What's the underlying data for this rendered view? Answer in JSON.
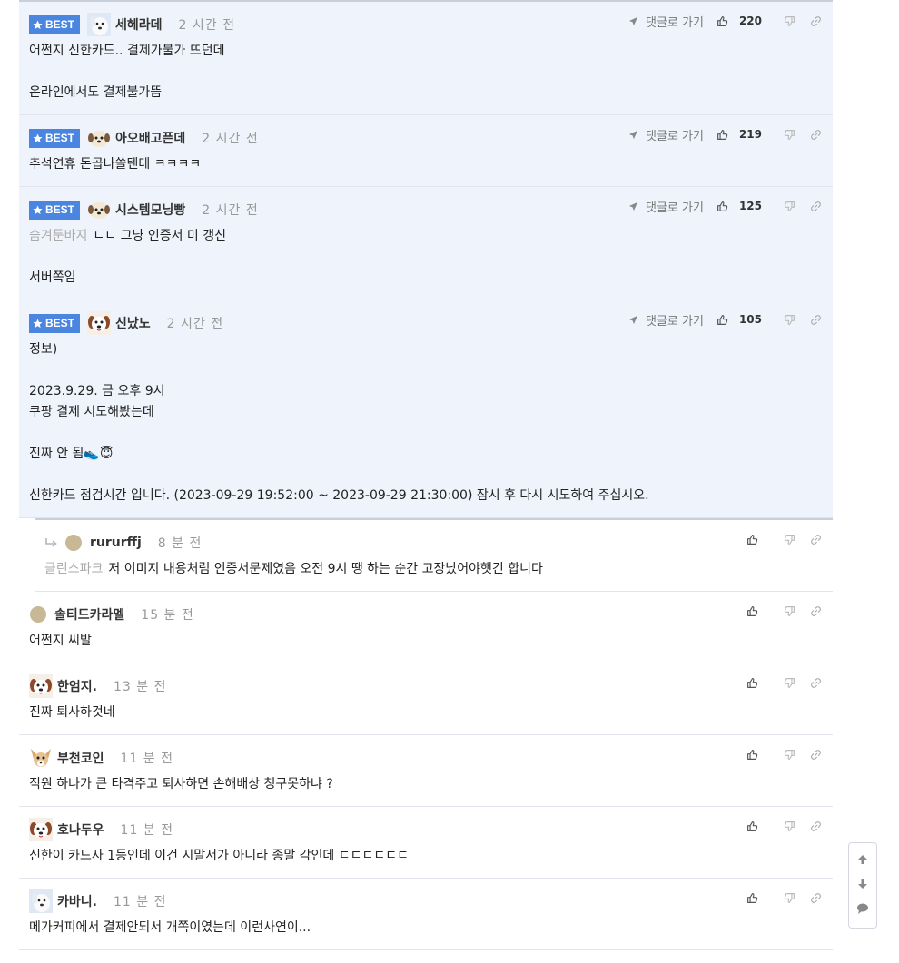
{
  "labels": {
    "best": "BEST",
    "goto_reply": "댓글로 가기"
  },
  "colors": {
    "best_bg": "#eef3fc",
    "badge": "#4a86e0"
  },
  "best_comments": [
    {
      "nickname": "세헤라데",
      "time": "2 시간 전",
      "likes": "220",
      "avatar": "dog-avatar",
      "lines": [
        "어쩐지 신한카드.. 결제가불가 뜨던데",
        "",
        "온라인에서도 결제불가뜸"
      ]
    },
    {
      "nickname": "아오배고픈데",
      "time": "2 시간 전",
      "likes": "219",
      "avatar": "puppy-avatar",
      "lines": [
        "추석연휴 돈곱나쏠텐데 ㅋㅋㅋㅋ"
      ]
    },
    {
      "nickname": "시스템모닝빵",
      "time": "2 시간 전",
      "likes": "125",
      "avatar": "puppy-avatar",
      "mention": "숨겨둔바지",
      "lines": [
        "ㄴㄴ 그냥 인증서 미 갱신",
        "",
        "서버쪽임"
      ]
    },
    {
      "nickname": "신났노",
      "time": "2 시간 전",
      "likes": "105",
      "avatar": "dog-face-avatar",
      "lines": [
        "정보)",
        "",
        "2023.9.29. 금 오후 9시",
        "쿠팡 결제 시도해봤는데",
        "",
        "진짜 안 됨👟😇",
        "",
        "신한카드 점검시간 입니다. (2023-09-29 19:52:00 ~ 2023-09-29 21:30:00) 잠시 후 다시 시도하여 주십시오."
      ]
    }
  ],
  "comments": [
    {
      "nickname": "rururffj",
      "time": "8 분 전",
      "is_reply": true,
      "avatar": "default-avatar",
      "mention": "클린스파크",
      "lines": [
        "저 이미지 내용처럼 인증서문제였음 오전 9시 땡 하는 순간 고장났어야햇긴 합니다"
      ]
    },
    {
      "nickname": "솔티드카라멜",
      "time": "15 분 전",
      "avatar": "default-avatar",
      "lines": [
        "어쩐지 씨발"
      ]
    },
    {
      "nickname": "한엄지.",
      "time": "13 분 전",
      "avatar": "dog-face-avatar",
      "lines": [
        "진짜 퇴사하것네"
      ]
    },
    {
      "nickname": "부천코인",
      "time": "11 분 전",
      "avatar": "chihuahua-avatar",
      "lines": [
        "직원 하나가 큰 타격주고 퇴사하면 손해배상 청구못하냐 ?"
      ]
    },
    {
      "nickname": "호나두우",
      "time": "11 분 전",
      "avatar": "dog-face-avatar",
      "lines": [
        "신한이 카드사 1등인데 이건 시말서가 아니라 종말 각인데 ㄷㄷㄷㄷㄷㄷ"
      ]
    },
    {
      "nickname": "카바니.",
      "time": "11 분 전",
      "avatar": "dog-avatar",
      "lines": [
        "메가커피에서 결제안되서 개쪽이였는데 이런사연이..."
      ]
    }
  ]
}
